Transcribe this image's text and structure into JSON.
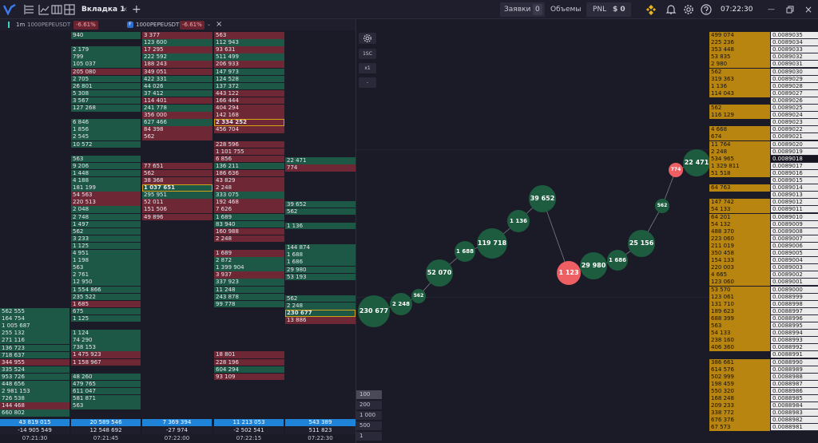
{
  "topbar": {
    "tab_label": "Вкладка 1",
    "orders_label": "Заявки",
    "orders_count": "0",
    "volumes_label": "Объемы",
    "pnl_label": "PNL",
    "pnl_value": "$ 0",
    "time": "07:22:30"
  },
  "subbar": {
    "timeframe": "1m",
    "symbol1": "1000PEPEUSDT",
    "change1": "-6.61%",
    "exchange_badge": "F",
    "symbol2": "1000PEPEUSDT",
    "change2": "-6.61%"
  },
  "clusters": [
    {
      "cells": [
        [
          "562 555",
          "g"
        ],
        [
          "164 754",
          "g"
        ],
        [
          "1 005 687",
          "g"
        ],
        [
          "255 132",
          "g"
        ],
        [
          "271 116",
          "g"
        ],
        [
          "136 723",
          "g"
        ],
        [
          "718 637",
          "g"
        ],
        [
          "344 955",
          "r"
        ],
        [
          "335 524",
          "g"
        ],
        [
          "953 726",
          "g"
        ],
        [
          "448 656",
          "g"
        ],
        [
          "2 981 153",
          "g"
        ],
        [
          "726 538",
          "g"
        ],
        [
          "144 468",
          "r"
        ],
        [
          "660 802",
          "g"
        ]
      ]
    },
    {
      "cells": [
        [
          "940",
          "g"
        ],
        [
          "",
          ""
        ],
        [
          "2 179",
          "g"
        ],
        [
          "799",
          "g"
        ],
        [
          "105 037",
          "g"
        ],
        [
          "205 080",
          "r"
        ],
        [
          "2 705",
          "g"
        ],
        [
          "26 801",
          "g"
        ],
        [
          "5 308",
          "g"
        ],
        [
          "3 567",
          "g"
        ],
        [
          "127 268",
          "g"
        ],
        [
          "",
          ""
        ],
        [
          "6 846",
          "g"
        ],
        [
          "1 856",
          "g"
        ],
        [
          "2 545",
          "g"
        ],
        [
          "10 572",
          "g"
        ],
        [
          "",
          ""
        ],
        [
          "563",
          "g"
        ],
        [
          "9 206",
          "g"
        ],
        [
          "1 448",
          "g"
        ],
        [
          "4 188",
          "g"
        ],
        [
          "181 199",
          "g"
        ],
        [
          "54 563",
          "r"
        ],
        [
          "220 513",
          "r"
        ],
        [
          "2 048",
          "g"
        ],
        [
          "2 748",
          "g"
        ],
        [
          "1 497",
          "g"
        ],
        [
          "562",
          "g"
        ],
        [
          "3 233",
          "g"
        ],
        [
          "1 125",
          "g"
        ],
        [
          "4 951",
          "g"
        ],
        [
          "1 198",
          "g"
        ],
        [
          "563",
          "g"
        ],
        [
          "2 761",
          "g"
        ],
        [
          "12 950",
          "g"
        ],
        [
          "1 554 866",
          "g"
        ],
        [
          "235 522",
          "g"
        ],
        [
          "1 685",
          "r"
        ],
        [
          "675",
          "g"
        ],
        [
          "1 125",
          "g"
        ],
        [
          "",
          ""
        ],
        [
          "1 124",
          "g"
        ],
        [
          "74 290",
          "g"
        ],
        [
          "738 153",
          "g"
        ],
        [
          "1 475 923",
          "r"
        ],
        [
          "1 158 967",
          "r"
        ],
        [
          "",
          ""
        ],
        [
          "48 260",
          "g"
        ],
        [
          "479 765",
          "g"
        ],
        [
          "611 047",
          "g"
        ],
        [
          "581 871",
          "g"
        ],
        [
          "563",
          "g"
        ]
      ]
    },
    {
      "cells": [
        [
          "3 377",
          "r"
        ],
        [
          "123 600",
          "g"
        ],
        [
          "17 295",
          "r"
        ],
        [
          "222 592",
          "g"
        ],
        [
          "188 243",
          "r"
        ],
        [
          "349 051",
          "r"
        ],
        [
          "422 331",
          "g"
        ],
        [
          "44 026",
          "g"
        ],
        [
          "37 412",
          "g"
        ],
        [
          "114 401",
          "r"
        ],
        [
          "241 778",
          "g"
        ],
        [
          "356 000",
          "r"
        ],
        [
          "627 466",
          "g"
        ],
        [
          "84 398",
          "r"
        ],
        [
          "562",
          "r"
        ],
        [
          "",
          ""
        ],
        [
          "",
          ""
        ],
        [
          "",
          ""
        ],
        [
          "77 651",
          "r"
        ],
        [
          "562",
          "r"
        ],
        [
          "38 368",
          "r"
        ],
        [
          "1 037 651",
          "g hl"
        ],
        [
          "295 951",
          "g"
        ],
        [
          "52 011",
          "r"
        ],
        [
          "151 506",
          "r"
        ],
        [
          "49 896",
          "r"
        ]
      ]
    },
    {
      "cells": [
        [
          "563",
          "r"
        ],
        [
          "112 943",
          "g"
        ],
        [
          "93 631",
          "r"
        ],
        [
          "511 499",
          "g"
        ],
        [
          "206 933",
          "r"
        ],
        [
          "147 973",
          "g"
        ],
        [
          "124 528",
          "g"
        ],
        [
          "137 372",
          "g"
        ],
        [
          "443 122",
          "r"
        ],
        [
          "166 444",
          "r"
        ],
        [
          "404 294",
          "r"
        ],
        [
          "142 168",
          "r"
        ],
        [
          "2 334 252",
          "r hl"
        ],
        [
          "456 704",
          "r"
        ],
        [
          "",
          ""
        ],
        [
          "228 596",
          "r"
        ],
        [
          "1 101 755",
          "r"
        ],
        [
          "6 856",
          "r"
        ],
        [
          "136 211",
          "g"
        ],
        [
          "186 636",
          "r"
        ],
        [
          "43 829",
          "r"
        ],
        [
          "2 248",
          "r"
        ],
        [
          "333 075",
          "g"
        ],
        [
          "192 468",
          "r"
        ],
        [
          "7 626",
          "r"
        ],
        [
          "1 689",
          "g"
        ],
        [
          "83 940",
          "g"
        ],
        [
          "160 988",
          "r"
        ],
        [
          "2 248",
          "r"
        ],
        [
          "",
          ""
        ],
        [
          "1 689",
          "r"
        ],
        [
          "2 872",
          "g"
        ],
        [
          "1 399 904",
          "g"
        ],
        [
          "3 937",
          "r"
        ],
        [
          "337 923",
          "g"
        ],
        [
          "11 248",
          "g"
        ],
        [
          "243 878",
          "g"
        ],
        [
          "99 778",
          "g"
        ],
        [
          "",
          ""
        ],
        [
          "",
          ""
        ],
        [
          "",
          ""
        ],
        [
          "",
          ""
        ],
        [
          "",
          ""
        ],
        [
          "",
          ""
        ],
        [
          "18 801",
          "r"
        ],
        [
          "228 196",
          "r"
        ],
        [
          "604 294",
          "g"
        ],
        [
          "93 109",
          "r"
        ]
      ]
    },
    {
      "cells": [
        [
          "22 471",
          "g"
        ],
        [
          "774",
          "r"
        ],
        [
          "",
          ""
        ],
        [
          "",
          ""
        ],
        [
          "",
          ""
        ],
        [
          "",
          ""
        ],
        [
          "39 652",
          "g"
        ],
        [
          "562",
          "g"
        ],
        [
          "",
          ""
        ],
        [
          "1 136",
          "g"
        ],
        [
          "",
          ""
        ],
        [
          "",
          ""
        ],
        [
          "144 874",
          "g"
        ],
        [
          "1 688",
          "g"
        ],
        [
          "1 686",
          "g"
        ],
        [
          "29 980",
          "g"
        ],
        [
          "53 193",
          "g"
        ],
        [
          "",
          ""
        ],
        [
          "",
          ""
        ],
        [
          "562",
          "g"
        ],
        [
          "2 248",
          "g"
        ],
        [
          "230 677",
          "g hl"
        ],
        [
          "13 886",
          "r"
        ]
      ]
    }
  ],
  "bottom": {
    "totals": [
      "43 819 015",
      "20 589 546",
      "7 369 394",
      "11 213 053",
      "543 389"
    ],
    "deltas": [
      "-14 905 549",
      "12 548 692",
      "-27 974",
      "-2 502 541",
      "511 823"
    ],
    "times": [
      "07:21:30",
      "07:21:45",
      "07:22:00",
      "07:22:15",
      "07:22:30"
    ]
  },
  "chart": {
    "controls": [
      "1SC",
      "x1",
      "-"
    ],
    "scale_options": [
      "100",
      "200",
      "1 000",
      "500",
      "1"
    ],
    "trades": [
      {
        "volume": "230 677",
        "side": "buy"
      },
      {
        "volume": "2 248",
        "side": "buy"
      },
      {
        "volume": "562",
        "side": "buy"
      },
      {
        "volume": "52 070",
        "side": "buy"
      },
      {
        "volume": "1 688",
        "side": "buy"
      },
      {
        "volume": "119 718",
        "side": "buy"
      },
      {
        "volume": "1 136",
        "side": "buy"
      },
      {
        "volume": "39 652",
        "side": "buy"
      },
      {
        "volume": "1 123",
        "side": "sell"
      },
      {
        "volume": "29 980",
        "side": "buy"
      },
      {
        "volume": "1 686",
        "side": "buy"
      },
      {
        "volume": "25 156",
        "side": "buy"
      },
      {
        "volume": "562",
        "side": "buy"
      },
      {
        "volume": "774",
        "side": "sell"
      },
      {
        "volume": "22 471",
        "side": "buy"
      }
    ],
    "colors": {
      "buy": "#1d5c3f",
      "sell": "#ee5f64",
      "accent": "#d4a017"
    }
  },
  "orderbook": {
    "rows": [
      [
        "499 074",
        "0.0089035"
      ],
      [
        "225 236",
        "0.0089034"
      ],
      [
        "353 448",
        "0.0089033"
      ],
      [
        "53 835",
        "0.0089032"
      ],
      [
        "2 980",
        "0.0089031"
      ],
      [
        "562",
        "0.0089030"
      ],
      [
        "319 363",
        "0.0089029"
      ],
      [
        "1 136",
        "0.0089028"
      ],
      [
        "114 043",
        "0.0089027"
      ],
      [
        "",
        "0.0089026"
      ],
      [
        "562",
        "0.0089025"
      ],
      [
        "116 129",
        "0.0089024"
      ],
      [
        "",
        "0.0089023"
      ],
      [
        "4 668",
        "0.0089022"
      ],
      [
        "674",
        "0.0089021"
      ],
      [
        "11 764",
        "0.0089020"
      ],
      [
        "2 248",
        "0.0089019"
      ],
      [
        "534 965",
        "0.0089018"
      ],
      [
        "1 329 811",
        "0.0089017"
      ],
      [
        "51 518",
        "0.0089016"
      ],
      [
        "",
        "0.0089015"
      ],
      [
        "64 763",
        "0.0089014"
      ],
      [
        "",
        "0.0089013"
      ],
      [
        "147 742",
        "0.0089012"
      ],
      [
        "54 133",
        "0.0089011"
      ],
      [
        "64 201",
        "0.0089010"
      ],
      [
        "54 132",
        "0.0089009"
      ],
      [
        "488 370",
        "0.0089008"
      ],
      [
        "223 060",
        "0.0089007"
      ],
      [
        "211 019",
        "0.0089006"
      ],
      [
        "350 458",
        "0.0089005"
      ],
      [
        "154 133",
        "0.0089004"
      ],
      [
        "220 003",
        "0.0089003"
      ],
      [
        "4 665",
        "0.0089002"
      ],
      [
        "123 060",
        "0.0089001"
      ],
      [
        "53 570",
        "0.0089000"
      ],
      [
        "123 061",
        "0.0088999"
      ],
      [
        "131 710",
        "0.0088998"
      ],
      [
        "189 623",
        "0.0088997"
      ],
      [
        "688 399",
        "0.0088996"
      ],
      [
        "563",
        "0.0088995"
      ],
      [
        "54 133",
        "0.0088994"
      ],
      [
        "238 160",
        "0.0088993"
      ],
      [
        "406 360",
        "0.0088992"
      ],
      [
        "",
        "0.0088991"
      ],
      [
        "386 661",
        "0.0088990"
      ],
      [
        "614 576",
        "0.0088989"
      ],
      [
        "502 999",
        "0.0088988"
      ],
      [
        "198 459",
        "0.0088987"
      ],
      [
        "550 320",
        "0.0088986"
      ],
      [
        "168 248",
        "0.0088985"
      ],
      [
        "209 233",
        "0.0088984"
      ],
      [
        "338 772",
        "0.0088983"
      ],
      [
        "676 376",
        "0.0088982"
      ],
      [
        "67 573",
        "0.0088981"
      ]
    ]
  }
}
